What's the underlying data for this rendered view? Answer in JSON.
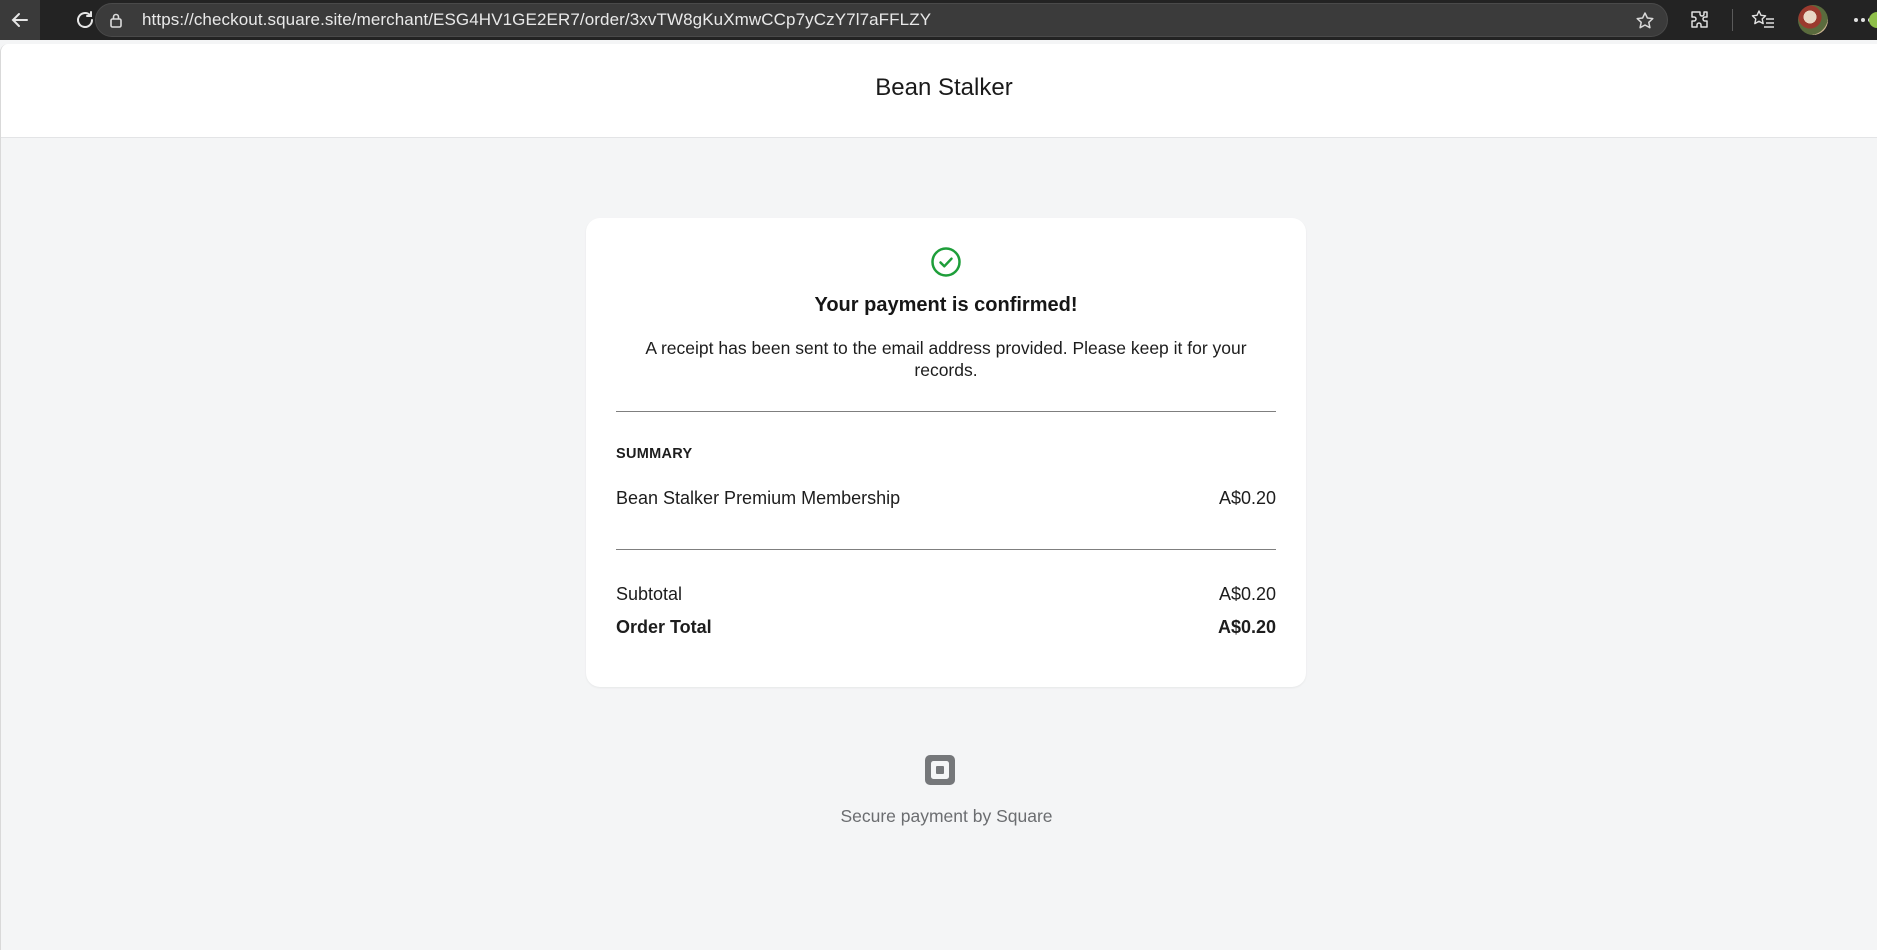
{
  "browser": {
    "url": "https://checkout.square.site/merchant/ESG4HV1GE2ER7/order/3xvTW8gKuXmwCCp7yCzY7l7aFFLZY"
  },
  "header": {
    "merchant_name": "Bean Stalker"
  },
  "confirmation": {
    "title": "Your payment is confirmed!",
    "message": "A receipt has been sent to the email address provided. Please keep it for your records."
  },
  "summary": {
    "label": "SUMMARY",
    "items": [
      {
        "name": "Bean Stalker Premium Membership",
        "price": "A$0.20"
      }
    ],
    "subtotal_label": "Subtotal",
    "subtotal_value": "A$0.20",
    "total_label": "Order Total",
    "total_value": "A$0.20"
  },
  "footer": {
    "secure_text": "Secure payment by Square"
  },
  "colors": {
    "success_green": "#1e9e3a",
    "page_background": "#f4f5f6",
    "browser_chrome": "#232323"
  },
  "icons": [
    "back-arrow-icon",
    "refresh-icon",
    "lock-icon",
    "star-icon",
    "extensions-icon",
    "favorites-icon",
    "more-icon",
    "check-circle-icon",
    "square-logo-icon"
  ]
}
